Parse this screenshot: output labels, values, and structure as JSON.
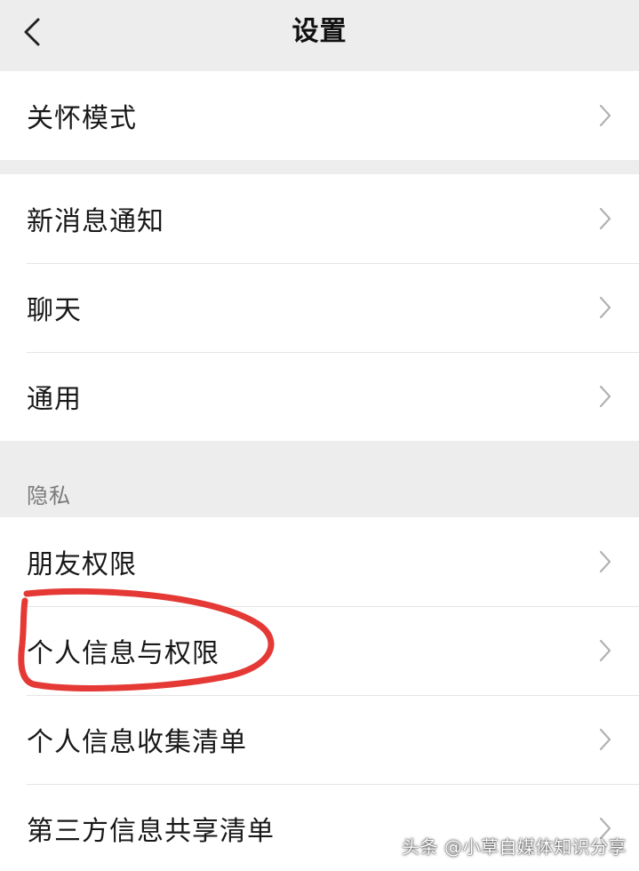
{
  "nav": {
    "title": "设置",
    "back_icon": "chevron-left-icon"
  },
  "groups": [
    {
      "items": [
        {
          "label": "关怀模式"
        }
      ]
    },
    {
      "items": [
        {
          "label": "新消息通知"
        },
        {
          "label": "聊天"
        },
        {
          "label": "通用"
        }
      ]
    },
    {
      "header": "隐私",
      "items": [
        {
          "label": "朋友权限"
        },
        {
          "label": "个人信息与权限"
        },
        {
          "label": "个人信息收集清单"
        },
        {
          "label": "第三方信息共享清单"
        }
      ]
    }
  ],
  "annotation": {
    "highlighted_item": "个人信息与权限",
    "color": "#e53935"
  },
  "watermark": "头条 @小草自媒体知识分享",
  "colors": {
    "background": "#ededed",
    "surface": "#ffffff",
    "chevron": "#b2b2b2",
    "section_text": "#7a7a7a"
  }
}
